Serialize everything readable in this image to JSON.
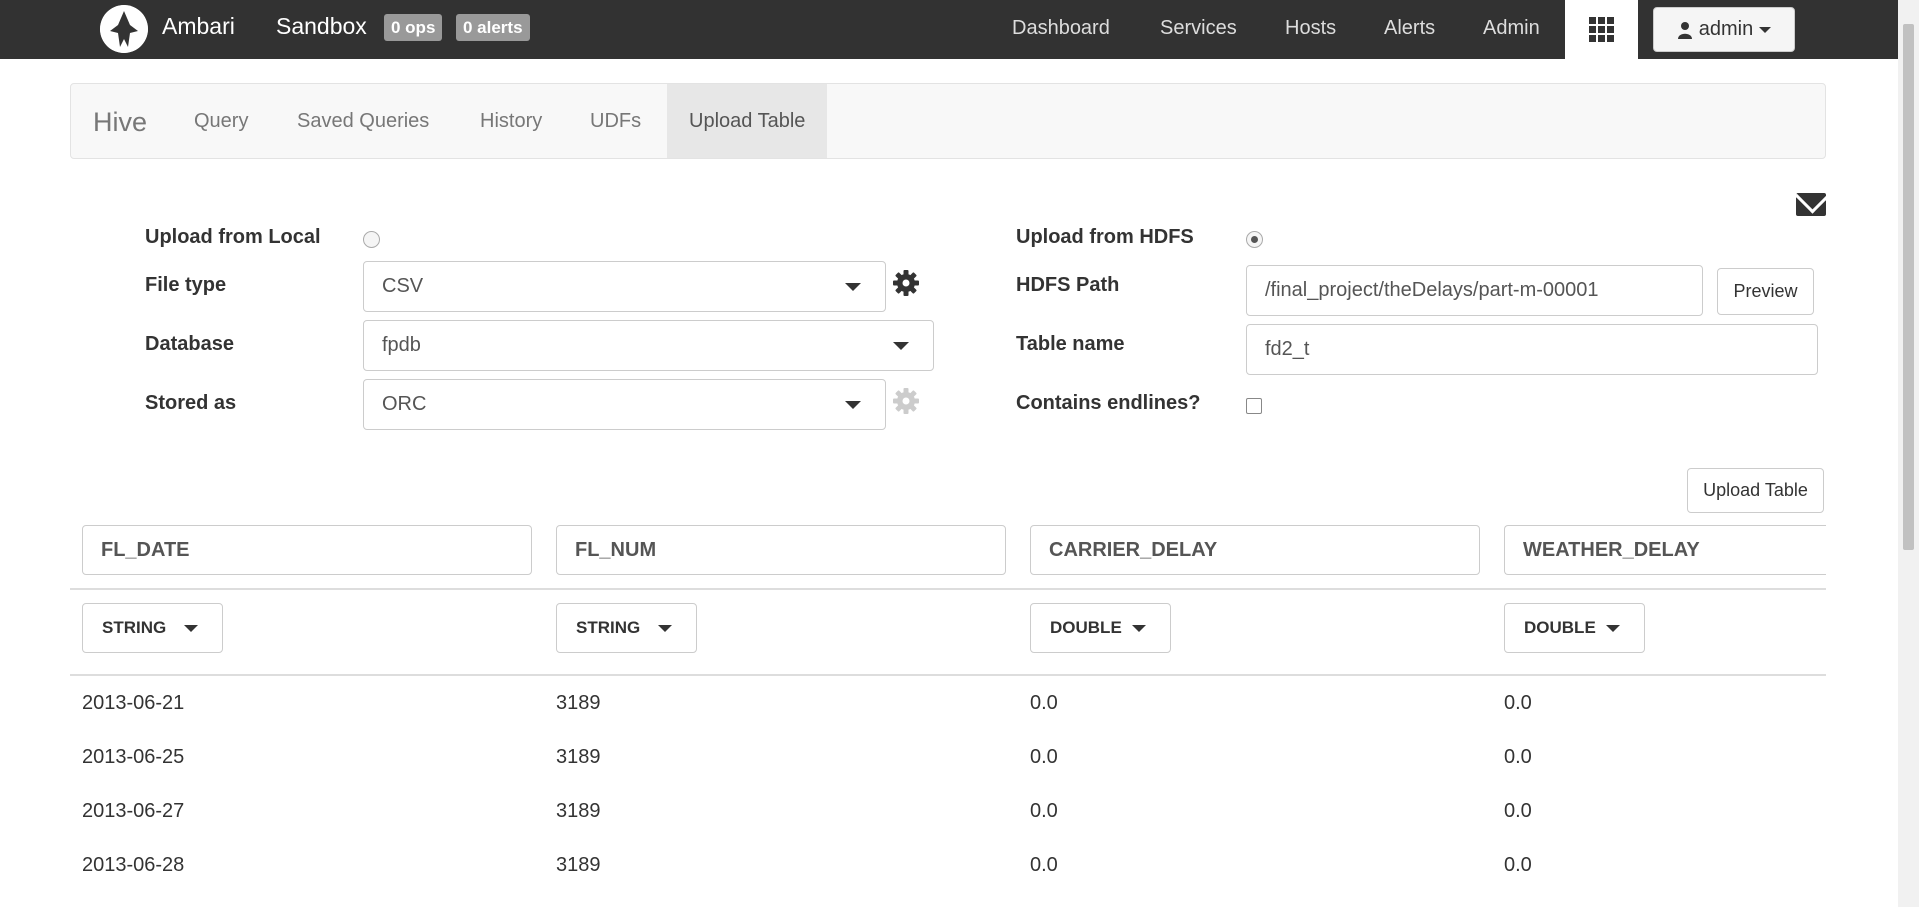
{
  "topbar": {
    "brand": "Ambari",
    "cluster": "Sandbox",
    "ops_badge": "0 ops",
    "alerts_badge": "0 alerts",
    "nav": [
      "Dashboard",
      "Services",
      "Hosts",
      "Alerts",
      "Admin"
    ],
    "user": "admin"
  },
  "subnav": {
    "title": "Hive",
    "tabs": [
      "Query",
      "Saved Queries",
      "History",
      "UDFs",
      "Upload Table"
    ],
    "active_tab": "Upload Table"
  },
  "form": {
    "upload_local_label": "Upload from Local",
    "upload_local_selected": false,
    "file_type_label": "File type",
    "file_type_value": "CSV",
    "database_label": "Database",
    "database_value": "fpdb",
    "stored_as_label": "Stored as",
    "stored_as_value": "ORC",
    "upload_hdfs_label": "Upload from HDFS",
    "upload_hdfs_selected": true,
    "hdfs_path_label": "HDFS Path",
    "hdfs_path_value": "/final_project/theDelays/part-m-00001",
    "preview_button": "Preview",
    "table_name_label": "Table name",
    "table_name_value": "fd2_t",
    "contains_endlines_label": "Contains endlines?",
    "contains_endlines_checked": false,
    "upload_table_button": "Upload Table"
  },
  "table": {
    "columns": [
      {
        "name": "FL_DATE",
        "type": "STRING"
      },
      {
        "name": "FL_NUM",
        "type": "STRING"
      },
      {
        "name": "CARRIER_DELAY",
        "type": "DOUBLE"
      },
      {
        "name": "WEATHER_DELAY",
        "type": "DOUBLE"
      }
    ],
    "rows": [
      [
        "2013-06-21",
        "3189",
        "0.0",
        "0.0"
      ],
      [
        "2013-06-25",
        "3189",
        "0.0",
        "0.0"
      ],
      [
        "2013-06-27",
        "3189",
        "0.0",
        "0.0"
      ],
      [
        "2013-06-28",
        "3189",
        "0.0",
        "0.0"
      ]
    ]
  },
  "colors": {
    "navbar_bg": "#323232",
    "badge_bg": "#999999",
    "active_tab_bg": "#e7e7e7"
  }
}
